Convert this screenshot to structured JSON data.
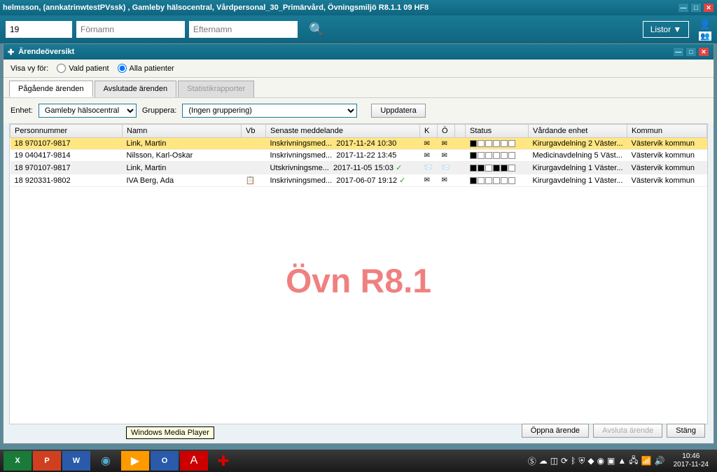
{
  "window": {
    "title": "helmsson, (annkatrinwtestPVssk) , Gamleby hälsocentral, Vårdpersonal_30_Primärvård, Övningsmiljö R8.1.1 09 HF8"
  },
  "search": {
    "value": "19",
    "fornamn_ph": "Förnamn",
    "efternamn_ph": "Efternamn",
    "listor": "Listor ▼"
  },
  "panel": {
    "title": "Ärendeöversikt",
    "visa_label": "Visa vy för:",
    "radio1": "Vald patient",
    "radio2": "Alla patienter"
  },
  "tabs": {
    "t1": "Pågående ärenden",
    "t2": "Avslutade ärenden",
    "t3": "Statistikrapporter"
  },
  "controls": {
    "enhet_label": "Enhet:",
    "enhet_value": "Gamleby hälsocentral",
    "gruppera_label": "Gruppera:",
    "gruppera_value": "(Ingen gruppering)",
    "uppdatera": "Uppdatera"
  },
  "headers": {
    "personnummer": "Personnummer",
    "namn": "Namn",
    "vb": "Vb",
    "senaste": "Senaste meddelande",
    "k": "K",
    "o": "Ö",
    "status": "Status",
    "vardande": "Vårdande enhet",
    "kommun": "Kommun"
  },
  "rows": [
    {
      "pn": "18 970107-9817",
      "namn": "Link, Martin",
      "msg": "Inskrivningsmed...",
      "date": "2017-11-24 10:30",
      "k": "✉",
      "o": "✉",
      "vard": "Kirurgavdelning 2 Väster...",
      "kommun": "Västervik kommun",
      "sel": true,
      "status": [
        1,
        0,
        0,
        0,
        0,
        0
      ]
    },
    {
      "pn": "19 040417-9814",
      "namn": "Nilsson, Karl-Oskar",
      "msg": "Inskrivningsmed...",
      "date": "2017-11-22 13:45",
      "k": "✉",
      "o": "✉",
      "vard": "Medicinavdelning 5 Väst...",
      "kommun": "Västervik kommun",
      "status": [
        1,
        0,
        0,
        0,
        0,
        0
      ]
    },
    {
      "pn": "18 970107-9817",
      "namn": "Link, Martin",
      "msg": "Utskrivningsme...",
      "date": "2017-11-05 15:03",
      "k": "📨",
      "o": "📨",
      "vard": "Kirurgavdelning 1 Väster...",
      "kommun": "Västervik kommun",
      "alt": true,
      "status": [
        1,
        1,
        0,
        1,
        1,
        0
      ],
      "extra": "✓"
    },
    {
      "pn": "18 920331-9802",
      "namn": "IVA Berg, Ada",
      "msg": "Inskrivningsmed...",
      "date": "2017-06-07 19:12",
      "k": "✉",
      "o": "✉",
      "vard": "Kirurgavdelning 1 Väster...",
      "kommun": "Västervik kommun",
      "vb": "📋",
      "extra": "✓",
      "status": [
        1,
        0,
        0,
        0,
        0,
        0
      ]
    }
  ],
  "watermark": "Övn R8.1",
  "buttons": {
    "oppna": "Öppna ärende",
    "avsluta": "Avsluta ärende",
    "stang": "Stäng"
  },
  "tooltip": "Windows Media Player",
  "taskbar": {
    "time": "10:46",
    "date": "2017-11-24"
  }
}
